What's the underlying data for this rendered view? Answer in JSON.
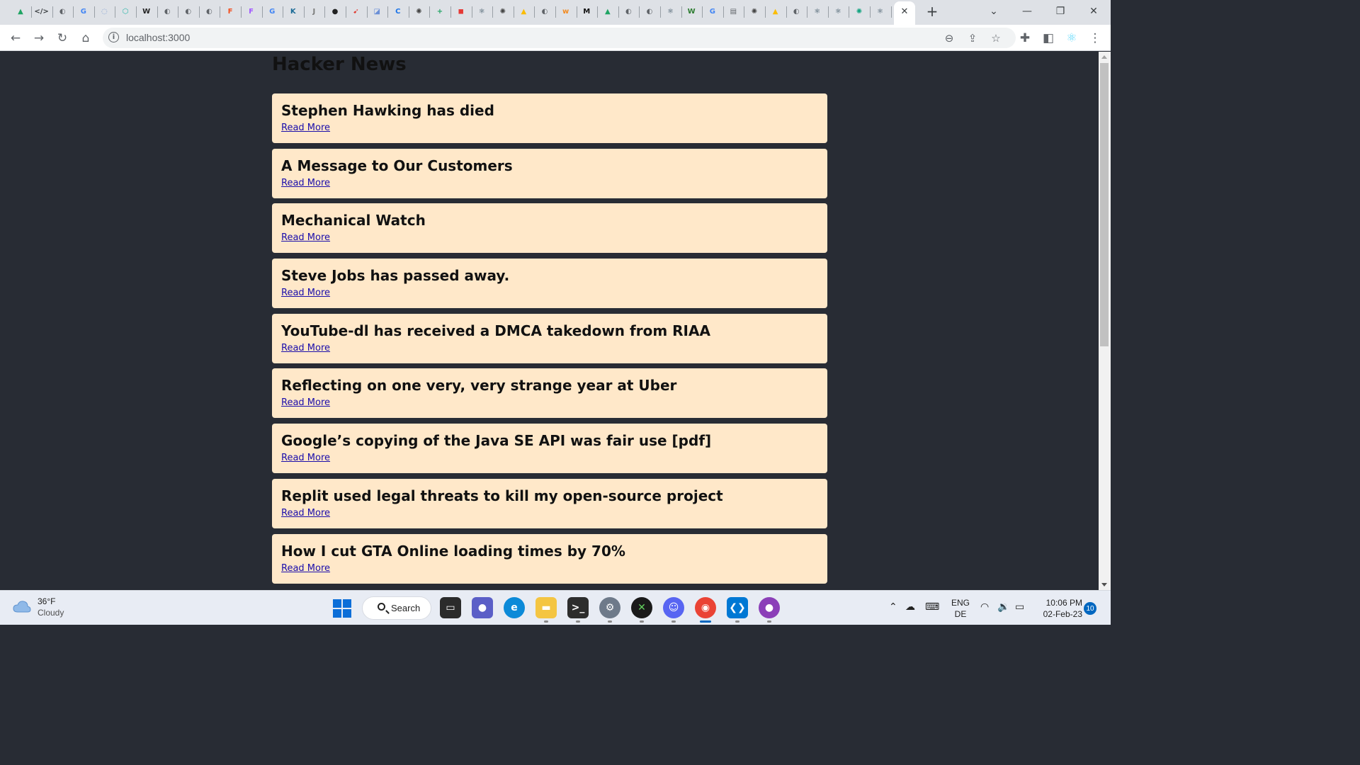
{
  "browser": {
    "url": "localhost:3000",
    "tab_favicons": [
      {
        "icon": "google-drive-icon",
        "glyph": "▲",
        "color": "#1fa463"
      },
      {
        "icon": "code-icon",
        "glyph": "</>",
        "color": "#3c4043"
      },
      {
        "icon": "globe-icon",
        "glyph": "◐",
        "color": "#5f6368"
      },
      {
        "icon": "google-icon",
        "glyph": "G",
        "color": "#4285f4"
      },
      {
        "icon": "globe-icon",
        "glyph": "◌",
        "color": "#7a9bd1"
      },
      {
        "icon": "link-icon",
        "glyph": "⬡",
        "color": "#29b6a8"
      },
      {
        "icon": "wikipedia-icon",
        "glyph": "W",
        "color": "#222222"
      },
      {
        "icon": "globe-icon",
        "glyph": "◐",
        "color": "#5f6368"
      },
      {
        "icon": "globe-icon",
        "glyph": "◐",
        "color": "#5f6368"
      },
      {
        "icon": "globe-icon",
        "glyph": "◐",
        "color": "#5f6368"
      },
      {
        "icon": "figma-icon",
        "glyph": "F",
        "color": "#f24e1e"
      },
      {
        "icon": "figma-icon",
        "glyph": "F",
        "color": "#a259ff"
      },
      {
        "icon": "google-icon",
        "glyph": "G",
        "color": "#4285f4"
      },
      {
        "icon": "k-icon",
        "glyph": "K",
        "color": "#1a6a96"
      },
      {
        "icon": "jira-icon",
        "glyph": "J",
        "color": "#7a7a7a"
      },
      {
        "icon": "github-icon",
        "glyph": "●",
        "color": "#222222"
      },
      {
        "icon": "swift-icon",
        "glyph": "➹",
        "color": "#e0362c"
      },
      {
        "icon": "box-icon",
        "glyph": "◪",
        "color": "#6b8fd6"
      },
      {
        "icon": "c-icon",
        "glyph": "C",
        "color": "#1a73e8"
      },
      {
        "icon": "chatgpt-icon",
        "glyph": "✺",
        "color": "#444444"
      },
      {
        "icon": "plus-square-icon",
        "glyph": "+",
        "color": "#1fa463"
      },
      {
        "icon": "red-square-icon",
        "glyph": "◼",
        "color": "#e53935"
      },
      {
        "icon": "react-icon",
        "glyph": "⚛",
        "color": "#1e3a4c"
      },
      {
        "icon": "chatgpt-icon",
        "glyph": "✺",
        "color": "#444444"
      },
      {
        "icon": "google-drive-icon",
        "glyph": "▲",
        "color": "#fbbc04"
      },
      {
        "icon": "globe-icon",
        "glyph": "◐",
        "color": "#5f6368"
      },
      {
        "icon": "w-icon",
        "glyph": "w",
        "color": "#f28b22"
      },
      {
        "icon": "medium-icon",
        "glyph": "M",
        "color": "#111111"
      },
      {
        "icon": "google-drive-icon",
        "glyph": "▲",
        "color": "#1fa463"
      },
      {
        "icon": "globe-icon",
        "glyph": "◐",
        "color": "#5f6368"
      },
      {
        "icon": "globe-icon",
        "glyph": "◐",
        "color": "#5f6368"
      },
      {
        "icon": "react-icon",
        "glyph": "⚛",
        "color": "#1e3a4c"
      },
      {
        "icon": "w-icon",
        "glyph": "W",
        "color": "#2e7d32"
      },
      {
        "icon": "google-icon",
        "glyph": "G",
        "color": "#4285f4"
      },
      {
        "icon": "docs-icon",
        "glyph": "▤",
        "color": "#5f6368"
      },
      {
        "icon": "chatgpt-icon",
        "glyph": "✺",
        "color": "#444444"
      },
      {
        "icon": "google-drive-icon",
        "glyph": "▲",
        "color": "#fbbc04"
      },
      {
        "icon": "globe-icon",
        "glyph": "◐",
        "color": "#5f6368"
      },
      {
        "icon": "react-icon",
        "glyph": "⚛",
        "color": "#1e3a4c"
      },
      {
        "icon": "react-icon",
        "glyph": "⚛",
        "color": "#1e3a4c"
      },
      {
        "icon": "openai-icon",
        "glyph": "✺",
        "color": "#10a37f"
      },
      {
        "icon": "react-icon",
        "glyph": "⚛",
        "color": "#1e3a4c"
      }
    ]
  },
  "page": {
    "title": "Hacker News",
    "read_more_label": "Read More",
    "stories": [
      {
        "title": "Stephen Hawking has died",
        "link_text": "Read More"
      },
      {
        "title": "A Message to Our Customers",
        "link_text": "Read More"
      },
      {
        "title": "Mechanical Watch",
        "link_text": "Read More"
      },
      {
        "title": "Steve Jobs has passed away.",
        "link_text": "Read More"
      },
      {
        "title": "YouTube-dl has received a DMCA takedown from RIAA",
        "link_text": "Read More"
      },
      {
        "title": "Reflecting on one very, very strange year at Uber",
        "link_text": "Read More"
      },
      {
        "title": "Google’s copying of the Java SE API was fair use [pdf]",
        "link_text": "Read More"
      },
      {
        "title": "Replit used legal threats to kill my open-source project",
        "link_text": "Read More"
      },
      {
        "title": "How I cut GTA Online loading times by 70%",
        "link_text": "Read More"
      }
    ],
    "colors": {
      "background": "#282c34",
      "card": "#ffe8c9",
      "link": "#1a0dab"
    }
  },
  "taskbar": {
    "weather": {
      "temp": "36°F",
      "condition": "Cloudy"
    },
    "search_label": "Search",
    "language": {
      "line1": "ENG",
      "line2": "DE"
    },
    "clock": {
      "time": "10:06 PM",
      "date": "02-Feb-23"
    },
    "notification_count": "10"
  }
}
